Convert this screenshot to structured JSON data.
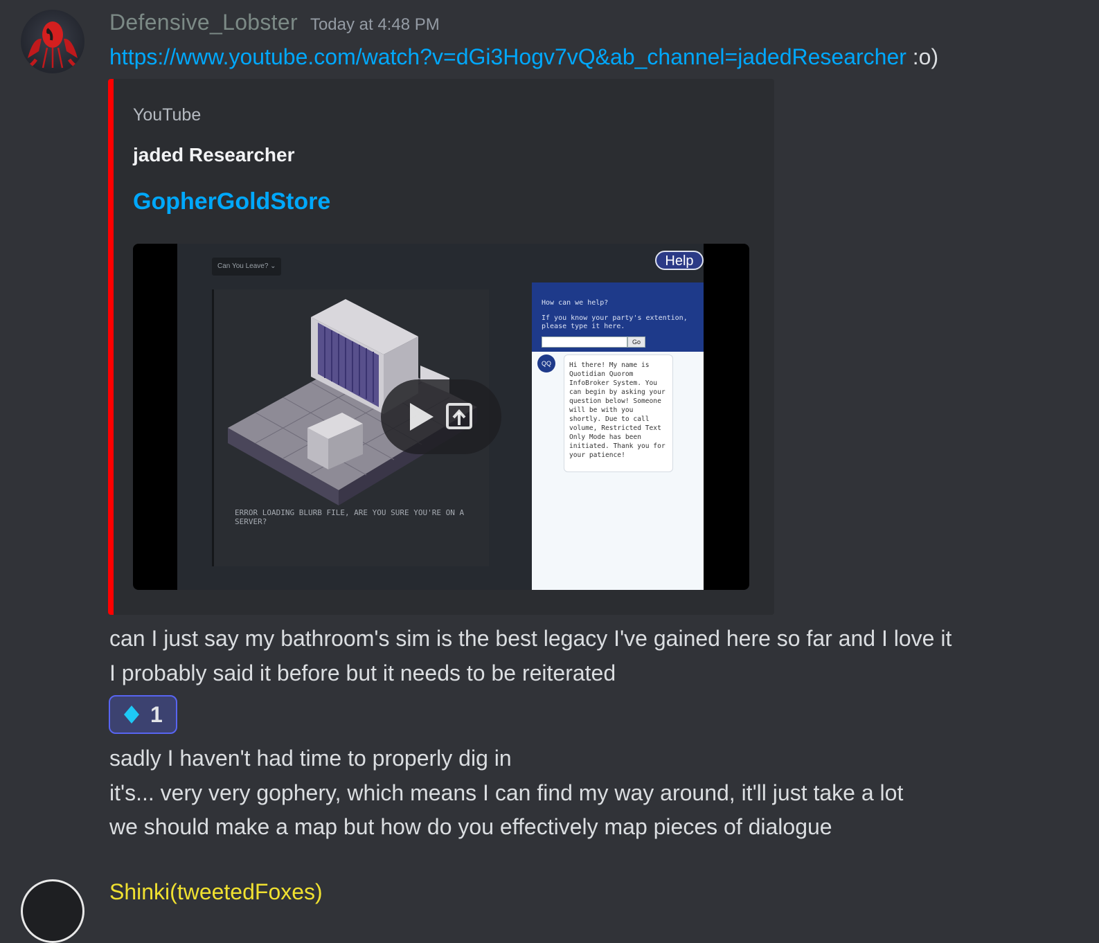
{
  "message": {
    "username": "Defensive_Lobster",
    "timestamp": "Today at 4:48 PM",
    "link": "https://www.youtube.com/watch?v=dGi3Hogv7vQ&ab_channel=jadedResearcher",
    "link_suffix": " :o)",
    "embed": {
      "accent_color": "#ff0000",
      "provider": "YouTube",
      "author": "jaded Researcher",
      "title": "GopherGoldStore",
      "thumbnail": {
        "dropdown_label": "Can You Leave?",
        "help_label": "Help",
        "error_text": "ERROR LOADING BLURB FILE, ARE YOU SURE YOU'RE ON A SERVER?",
        "chat_question": "How can we help?",
        "chat_prompt": "If you know your party's extention, please type it here.",
        "chat_go": "Go",
        "chat_badge": "QQ",
        "chat_bubble": "Hi there! My name is Quotidian Quorom InfoBroker System. You can begin by asking your question below! Someone will be with you shortly. Due to call volume, Restricted Text Only Mode has been initiated. Thank you for your patience!"
      },
      "play_icon": "play-icon",
      "open_external_icon": "open-external-icon"
    },
    "lines": [
      "can I just say my bathroom's sim is the best legacy I've gained here so far and I love it",
      "I probably said it before but it needs to be reiterated"
    ],
    "reaction": {
      "emoji_icon": "diamond-icon",
      "count": "1"
    },
    "lines_after": [
      "sadly I haven't had time to properly dig in",
      "it's... very very gophery, which means I can find my way around, it'll just take a lot",
      "we should make a map but how do you effectively map pieces of dialogue"
    ]
  },
  "next_message": {
    "username": "Shinki(tweetedFoxes)"
  },
  "colors": {
    "background": "#313338",
    "link": "#00a8fc",
    "reaction_border": "#5865f2",
    "next_username": "#f0e130"
  }
}
